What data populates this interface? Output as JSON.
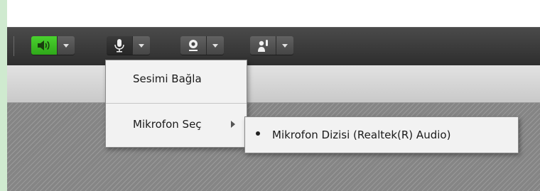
{
  "toolbar": {
    "buttons": [
      {
        "name": "speaker",
        "icon": "speaker-icon",
        "state": "on"
      },
      {
        "name": "microphone",
        "icon": "microphone-icon",
        "state": "menu-open"
      },
      {
        "name": "webcam",
        "icon": "webcam-icon",
        "state": "off"
      },
      {
        "name": "raise-hand",
        "icon": "raise-hand-icon",
        "state": "off"
      }
    ]
  },
  "mic_menu": {
    "connect_audio": "Sesimi Bağla",
    "select_mic": "Mikrofon Seç"
  },
  "mic_submenu": {
    "items": [
      {
        "label": "Mikrofon Dizisi (Realtek(R) Audio)",
        "selected": true
      }
    ]
  },
  "colors": {
    "active_green": "#3cc322",
    "toolbar_bg": "#3a3a3a"
  }
}
